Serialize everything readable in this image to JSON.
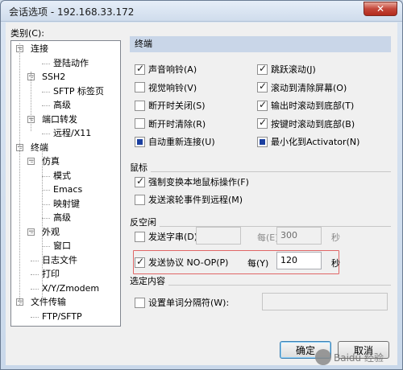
{
  "window": {
    "title": "会话选项 - 192.168.33.172",
    "close_glyph": "✕"
  },
  "category": {
    "label": "类别(C):",
    "tree": [
      {
        "label": "连接",
        "level": 0,
        "expander": "−"
      },
      {
        "label": "登陆动作",
        "level": 2
      },
      {
        "label": "SSH2",
        "level": 1,
        "expander": "−"
      },
      {
        "label": "SFTP 标签页",
        "level": 2
      },
      {
        "label": "高级",
        "level": 2
      },
      {
        "label": "端口转发",
        "level": 1,
        "expander": "−"
      },
      {
        "label": "远程/X11",
        "level": 2
      },
      {
        "label": "终端",
        "level": 0,
        "expander": "−"
      },
      {
        "label": "仿真",
        "level": 1,
        "expander": "−"
      },
      {
        "label": "模式",
        "level": 2
      },
      {
        "label": "Emacs",
        "level": 2
      },
      {
        "label": "映射键",
        "level": 2
      },
      {
        "label": "高级",
        "level": 2
      },
      {
        "label": "外观",
        "level": 1,
        "expander": "−"
      },
      {
        "label": "窗口",
        "level": 2
      },
      {
        "label": "日志文件",
        "level": 1
      },
      {
        "label": "打印",
        "level": 1
      },
      {
        "label": "X/Y/Zmodem",
        "level": 1
      },
      {
        "label": "文件传输",
        "level": 0,
        "expander": "−"
      },
      {
        "label": "FTP/SFTP",
        "level": 1
      }
    ]
  },
  "terminal": {
    "title": "终端",
    "left_options": [
      {
        "label": "声音响铃(A)",
        "checked": true
      },
      {
        "label": "视觉响铃(V)",
        "checked": false
      },
      {
        "label": "断开时关闭(S)",
        "checked": false
      },
      {
        "label": "断开时清除(R)",
        "checked": false
      },
      {
        "label": "自动重新连接(U)",
        "checked": "filled"
      }
    ],
    "right_options": [
      {
        "label": "跳跃滚动(J)",
        "checked": true
      },
      {
        "label": "滚动到清除屏幕(O)",
        "checked": true
      },
      {
        "label": "输出时滚动到底部(T)",
        "checked": true
      },
      {
        "label": "按键时滚动到底部(B)",
        "checked": true
      },
      {
        "label": "最小化到Activator(N)",
        "checked": "filled"
      }
    ]
  },
  "mouse": {
    "title": "鼠标",
    "options": [
      {
        "label": "强制变换本地鼠标操作(F)",
        "checked": true
      },
      {
        "label": "发送滚轮事件到远程(M)",
        "checked": false
      }
    ]
  },
  "anti_idle": {
    "title": "反空闲",
    "send_string_label": "发送字串(D):",
    "send_string_value": "",
    "every_label_1": "每(E)",
    "interval_1": "300",
    "unit_1": "秒",
    "send_noop_label": "发送协议  NO-OP(P)",
    "every_label_2": "每(Y)",
    "interval_2": "120",
    "unit_2": "秒"
  },
  "selection": {
    "title": "选定内容",
    "word_sep_label": "设置单词分隔符(W):",
    "word_sep_value": ""
  },
  "buttons": {
    "ok": "确定",
    "cancel": "取消"
  },
  "watermark": "Baidu 经验"
}
